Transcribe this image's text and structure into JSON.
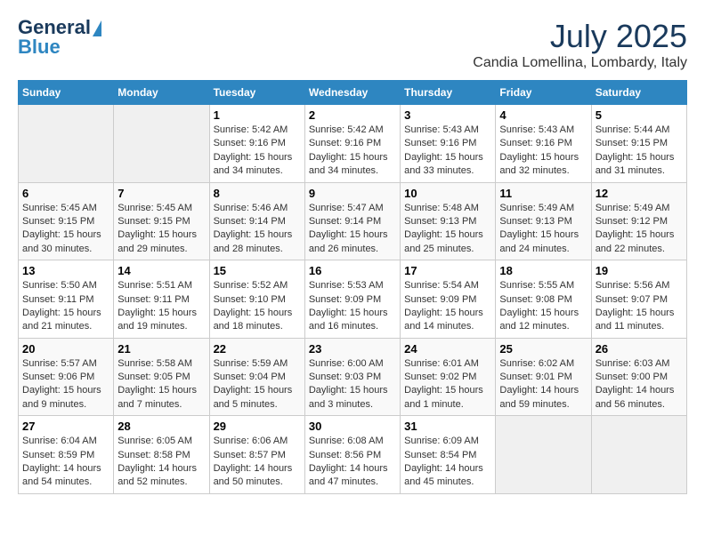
{
  "header": {
    "logo_line1": "General",
    "logo_line2": "Blue",
    "month_title": "July 2025",
    "location": "Candia Lomellina, Lombardy, Italy"
  },
  "days_of_week": [
    "Sunday",
    "Monday",
    "Tuesday",
    "Wednesday",
    "Thursday",
    "Friday",
    "Saturday"
  ],
  "weeks": [
    [
      {
        "day": "",
        "info": ""
      },
      {
        "day": "",
        "info": ""
      },
      {
        "day": "1",
        "info": "Sunrise: 5:42 AM\nSunset: 9:16 PM\nDaylight: 15 hours and 34 minutes."
      },
      {
        "day": "2",
        "info": "Sunrise: 5:42 AM\nSunset: 9:16 PM\nDaylight: 15 hours and 34 minutes."
      },
      {
        "day": "3",
        "info": "Sunrise: 5:43 AM\nSunset: 9:16 PM\nDaylight: 15 hours and 33 minutes."
      },
      {
        "day": "4",
        "info": "Sunrise: 5:43 AM\nSunset: 9:16 PM\nDaylight: 15 hours and 32 minutes."
      },
      {
        "day": "5",
        "info": "Sunrise: 5:44 AM\nSunset: 9:15 PM\nDaylight: 15 hours and 31 minutes."
      }
    ],
    [
      {
        "day": "6",
        "info": "Sunrise: 5:45 AM\nSunset: 9:15 PM\nDaylight: 15 hours and 30 minutes."
      },
      {
        "day": "7",
        "info": "Sunrise: 5:45 AM\nSunset: 9:15 PM\nDaylight: 15 hours and 29 minutes."
      },
      {
        "day": "8",
        "info": "Sunrise: 5:46 AM\nSunset: 9:14 PM\nDaylight: 15 hours and 28 minutes."
      },
      {
        "day": "9",
        "info": "Sunrise: 5:47 AM\nSunset: 9:14 PM\nDaylight: 15 hours and 26 minutes."
      },
      {
        "day": "10",
        "info": "Sunrise: 5:48 AM\nSunset: 9:13 PM\nDaylight: 15 hours and 25 minutes."
      },
      {
        "day": "11",
        "info": "Sunrise: 5:49 AM\nSunset: 9:13 PM\nDaylight: 15 hours and 24 minutes."
      },
      {
        "day": "12",
        "info": "Sunrise: 5:49 AM\nSunset: 9:12 PM\nDaylight: 15 hours and 22 minutes."
      }
    ],
    [
      {
        "day": "13",
        "info": "Sunrise: 5:50 AM\nSunset: 9:11 PM\nDaylight: 15 hours and 21 minutes."
      },
      {
        "day": "14",
        "info": "Sunrise: 5:51 AM\nSunset: 9:11 PM\nDaylight: 15 hours and 19 minutes."
      },
      {
        "day": "15",
        "info": "Sunrise: 5:52 AM\nSunset: 9:10 PM\nDaylight: 15 hours and 18 minutes."
      },
      {
        "day": "16",
        "info": "Sunrise: 5:53 AM\nSunset: 9:09 PM\nDaylight: 15 hours and 16 minutes."
      },
      {
        "day": "17",
        "info": "Sunrise: 5:54 AM\nSunset: 9:09 PM\nDaylight: 15 hours and 14 minutes."
      },
      {
        "day": "18",
        "info": "Sunrise: 5:55 AM\nSunset: 9:08 PM\nDaylight: 15 hours and 12 minutes."
      },
      {
        "day": "19",
        "info": "Sunrise: 5:56 AM\nSunset: 9:07 PM\nDaylight: 15 hours and 11 minutes."
      }
    ],
    [
      {
        "day": "20",
        "info": "Sunrise: 5:57 AM\nSunset: 9:06 PM\nDaylight: 15 hours and 9 minutes."
      },
      {
        "day": "21",
        "info": "Sunrise: 5:58 AM\nSunset: 9:05 PM\nDaylight: 15 hours and 7 minutes."
      },
      {
        "day": "22",
        "info": "Sunrise: 5:59 AM\nSunset: 9:04 PM\nDaylight: 15 hours and 5 minutes."
      },
      {
        "day": "23",
        "info": "Sunrise: 6:00 AM\nSunset: 9:03 PM\nDaylight: 15 hours and 3 minutes."
      },
      {
        "day": "24",
        "info": "Sunrise: 6:01 AM\nSunset: 9:02 PM\nDaylight: 15 hours and 1 minute."
      },
      {
        "day": "25",
        "info": "Sunrise: 6:02 AM\nSunset: 9:01 PM\nDaylight: 14 hours and 59 minutes."
      },
      {
        "day": "26",
        "info": "Sunrise: 6:03 AM\nSunset: 9:00 PM\nDaylight: 14 hours and 56 minutes."
      }
    ],
    [
      {
        "day": "27",
        "info": "Sunrise: 6:04 AM\nSunset: 8:59 PM\nDaylight: 14 hours and 54 minutes."
      },
      {
        "day": "28",
        "info": "Sunrise: 6:05 AM\nSunset: 8:58 PM\nDaylight: 14 hours and 52 minutes."
      },
      {
        "day": "29",
        "info": "Sunrise: 6:06 AM\nSunset: 8:57 PM\nDaylight: 14 hours and 50 minutes."
      },
      {
        "day": "30",
        "info": "Sunrise: 6:08 AM\nSunset: 8:56 PM\nDaylight: 14 hours and 47 minutes."
      },
      {
        "day": "31",
        "info": "Sunrise: 6:09 AM\nSunset: 8:54 PM\nDaylight: 14 hours and 45 minutes."
      },
      {
        "day": "",
        "info": ""
      },
      {
        "day": "",
        "info": ""
      }
    ]
  ]
}
